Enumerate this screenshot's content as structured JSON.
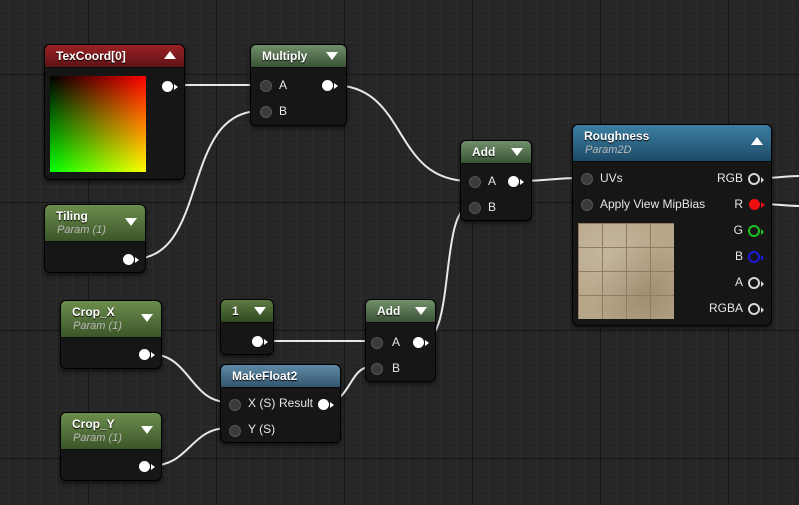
{
  "graph": {
    "texcoord": {
      "title": "TexCoord[0]"
    },
    "multiply": {
      "title": "Multiply",
      "pin_a": "A",
      "pin_b": "B"
    },
    "tiling": {
      "title": "Tiling",
      "subtitle": "Param (1)"
    },
    "add_top": {
      "title": "Add",
      "pin_a": "A",
      "pin_b": "B"
    },
    "roughness": {
      "title": "Roughness",
      "subtitle": "Param2D",
      "inputs": [
        "UVs",
        "Apply View MipBias"
      ],
      "outputs": [
        "RGB",
        "R",
        "G",
        "B",
        "A",
        "RGBA"
      ]
    },
    "crop_x": {
      "title": "Crop_X",
      "subtitle": "Param (1)"
    },
    "constant": {
      "title": "1"
    },
    "add_bottom": {
      "title": "Add",
      "pin_a": "A",
      "pin_b": "B"
    },
    "makefloat2": {
      "title": "MakeFloat2",
      "pin_x": "X (S)",
      "pin_y": "Y (S)",
      "output": "Result"
    },
    "crop_y": {
      "title": "Crop_Y",
      "subtitle": "Param (1)"
    }
  },
  "colors": {
    "wire": "#e8e8e8",
    "pin_red": "#ee1010",
    "pin_green": "#1ec21e",
    "pin_blue": "#1b1bd9"
  }
}
